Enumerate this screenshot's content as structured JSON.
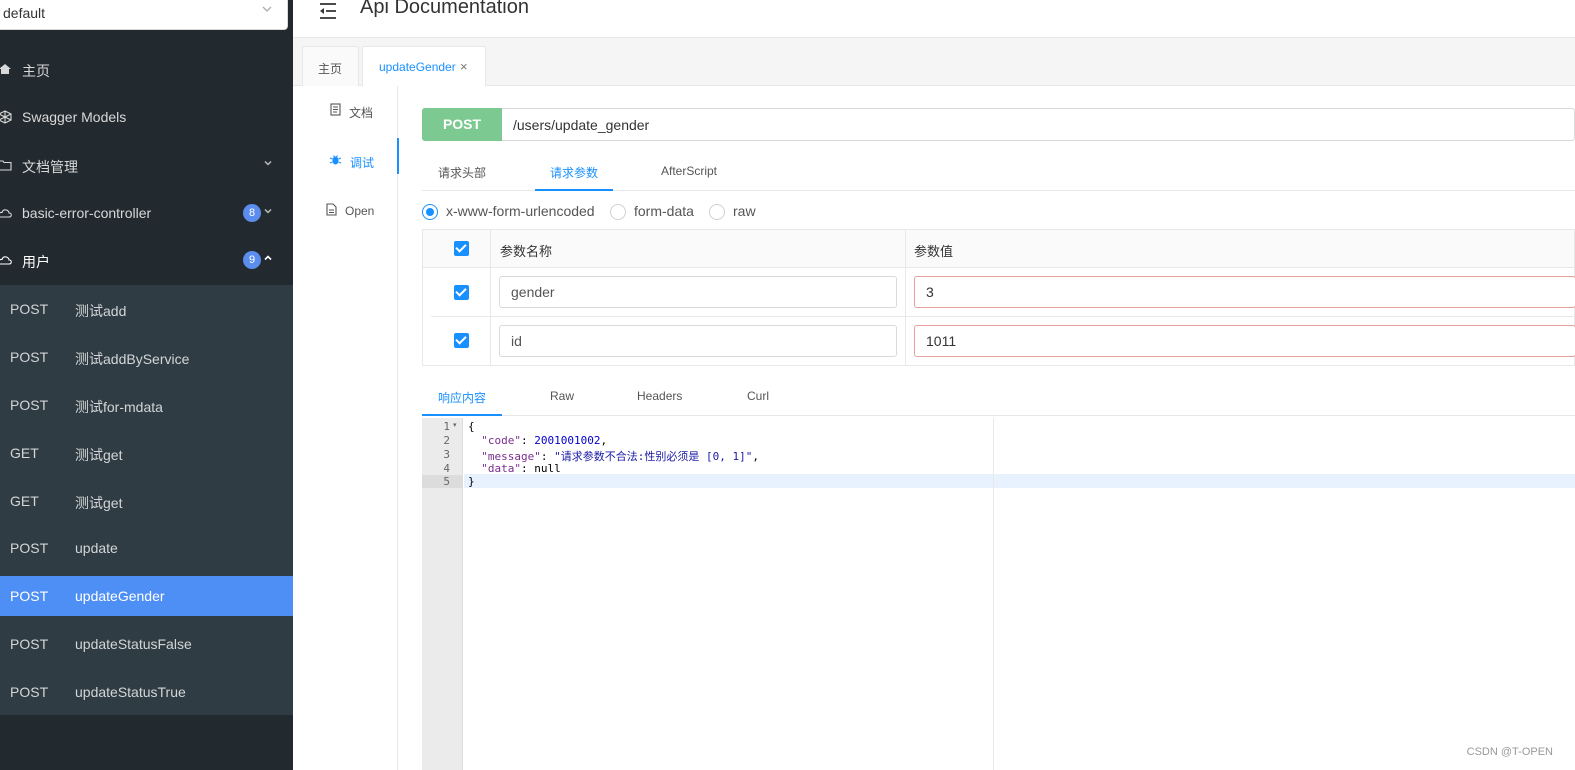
{
  "sidebar": {
    "group_select": {
      "value": "default",
      "chevron": "chevron-down-icon"
    },
    "items": [
      {
        "label": "主页",
        "icon": "home-icon"
      },
      {
        "label": "Swagger Models",
        "icon": "box-icon"
      },
      {
        "label": "文档管理",
        "icon": "folder-icon",
        "arrow": "⌄"
      },
      {
        "label": "basic-error-controller",
        "icon": "cloud-icon",
        "badge": "8",
        "arrow": "⌄"
      },
      {
        "label": "用户",
        "icon": "cloud-icon",
        "badge": "9",
        "arrow": "⌃"
      }
    ],
    "endpoints": [
      {
        "method": "POST",
        "name": "测试add"
      },
      {
        "method": "POST",
        "name": "测试addByService"
      },
      {
        "method": "POST",
        "name": "测试for-mdata"
      },
      {
        "method": "GET",
        "name": "测试get"
      },
      {
        "method": "GET",
        "name": "测试get"
      },
      {
        "method": "POST",
        "name": "update"
      },
      {
        "method": "POST",
        "name": "updateGender"
      },
      {
        "method": "POST",
        "name": "updateStatusFalse"
      },
      {
        "method": "POST",
        "name": "updateStatusTrue"
      }
    ]
  },
  "header": {
    "title": "Api Documentation"
  },
  "tabs": [
    {
      "label": "主页"
    },
    {
      "label": "updateGender",
      "close": "×"
    }
  ],
  "vtabs": [
    {
      "label": "文档",
      "icon": "document-icon"
    },
    {
      "label": "调试",
      "icon": "bug-icon"
    },
    {
      "label": "Open",
      "icon": "file-icon"
    }
  ],
  "request": {
    "method": "POST",
    "url": "/users/update_gender",
    "subtabs": [
      "请求头部",
      "请求参数",
      "AfterScript"
    ],
    "content_types": [
      "x-www-form-urlencoded",
      "form-data",
      "raw"
    ],
    "selected_content_type": "x-www-form-urlencoded",
    "table": {
      "headers": [
        "参数名称",
        "参数值"
      ],
      "rows": [
        {
          "name": "gender",
          "value": "3"
        },
        {
          "name": "id",
          "value": "1011"
        }
      ]
    }
  },
  "response": {
    "tabs": [
      "响应内容",
      "Raw",
      "Headers",
      "Curl"
    ],
    "line_numbers": [
      "1",
      "2",
      "3",
      "4",
      "5"
    ],
    "lines": {
      "l1": "{",
      "code_key": "\"code\"",
      "code_val": "2001001002",
      "message_key": "\"message\"",
      "message_val": "\"请求参数不合法:性别必须是 [0, 1]\"",
      "data_key": "\"data\"",
      "data_val": "null",
      "l5": "}"
    }
  },
  "watermark": "CSDN @T-OPEN",
  "colors": {
    "accent": "#1890ff",
    "post": "#7cc992",
    "sidebar": "#222a2f",
    "selected": "#4e8ff6"
  }
}
